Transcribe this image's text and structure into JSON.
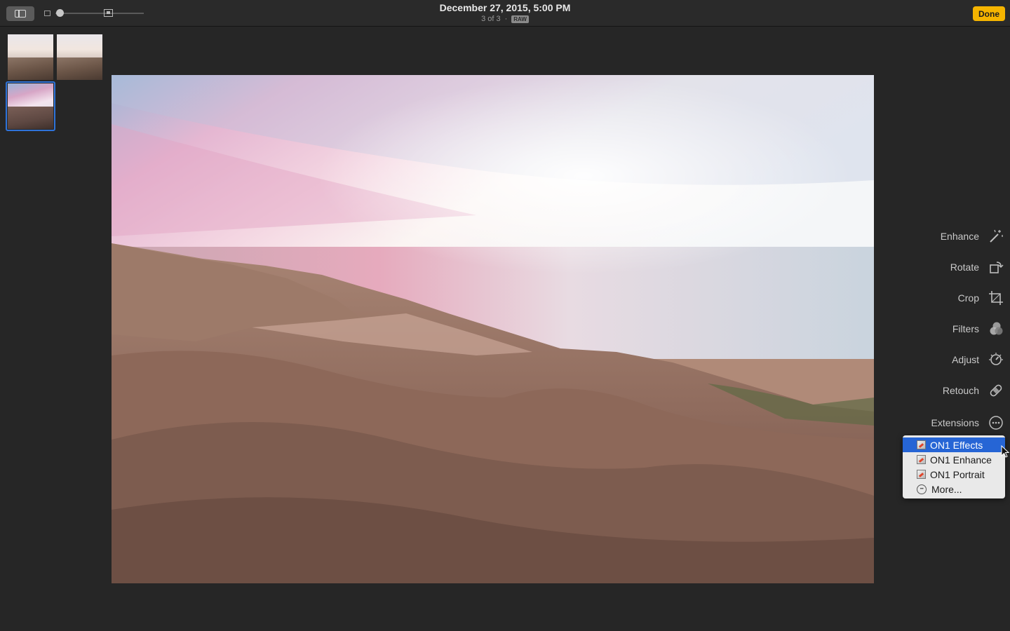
{
  "toolbar": {
    "sidebar_toggle_icon": "sidebar-icon",
    "zoom": {
      "small_icon": "small-photo-icon",
      "large_icon": "large-photo-icon",
      "value": 0.05
    },
    "title": "December 27, 2015, 5:00 PM",
    "position": "3 of 3",
    "separator": "·",
    "format_badge": "RAW",
    "done_label": "Done",
    "done_color": "#f5b400"
  },
  "filmstrip": {
    "thumbnails": [
      {
        "selected": false
      },
      {
        "selected": false
      },
      {
        "selected": true
      }
    ],
    "selection_color": "#2f73d9"
  },
  "tools": [
    {
      "label": "Enhance",
      "icon": "magic-wand-icon"
    },
    {
      "label": "Rotate",
      "icon": "rotate-icon"
    },
    {
      "label": "Crop",
      "icon": "crop-icon"
    },
    {
      "label": "Filters",
      "icon": "filters-icon"
    },
    {
      "label": "Adjust",
      "icon": "adjust-dial-icon"
    },
    {
      "label": "Retouch",
      "icon": "bandage-icon"
    },
    {
      "label": "Extensions",
      "icon": "ellipsis-circle-icon"
    }
  ],
  "extensions_menu": {
    "items": [
      {
        "label": "ON1 Effects",
        "icon": "on1-app-icon",
        "selected": true
      },
      {
        "label": "ON1 Enhance",
        "icon": "on1-app-icon",
        "selected": false
      },
      {
        "label": "ON1 Portrait",
        "icon": "on1-app-icon",
        "selected": false
      },
      {
        "label": "More...",
        "icon": "more-icon",
        "selected": false
      }
    ],
    "highlight_color": "#2665d5"
  }
}
